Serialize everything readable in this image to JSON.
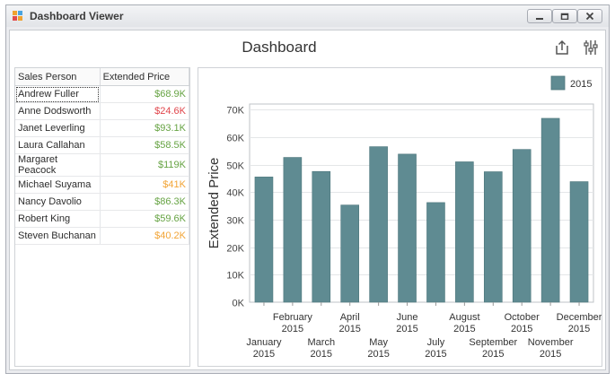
{
  "window": {
    "title": "Dashboard Viewer",
    "controls": [
      "minimize",
      "maximize",
      "close"
    ]
  },
  "dashboard": {
    "title": "Dashboard",
    "tools": [
      "export-icon",
      "parameters-icon"
    ]
  },
  "grid": {
    "columns": [
      "Sales Person",
      "Extended Price"
    ],
    "rows": [
      {
        "name": "Andrew Fuller",
        "value": "$68.9K",
        "color": "#66a343"
      },
      {
        "name": "Anne Dodsworth",
        "value": "$24.6K",
        "color": "#e0454b"
      },
      {
        "name": "Janet Leverling",
        "value": "$93.1K",
        "color": "#66a343"
      },
      {
        "name": "Laura Callahan",
        "value": "$58.5K",
        "color": "#66a343"
      },
      {
        "name": "Margaret Peacock",
        "value": "$119K",
        "color": "#66a343"
      },
      {
        "name": "Michael Suyama",
        "value": "$41K",
        "color": "#f2a435"
      },
      {
        "name": "Nancy Davolio",
        "value": "$86.3K",
        "color": "#66a343"
      },
      {
        "name": "Robert King",
        "value": "$59.6K",
        "color": "#66a343"
      },
      {
        "name": "Steven Buchanan",
        "value": "$40.2K",
        "color": "#f2a435"
      }
    ],
    "selected_row": 0
  },
  "chart_data": {
    "type": "bar",
    "title": "",
    "xlabel": "",
    "ylabel": "Extended Price",
    "categories": [
      "January 2015",
      "February 2015",
      "March 2015",
      "April 2015",
      "May 2015",
      "June 2015",
      "July 2015",
      "August 2015",
      "September 2015",
      "October 2015",
      "November 2015",
      "December 2015"
    ],
    "category_lines": [
      [
        "January",
        "2015"
      ],
      [
        "February",
        "2015"
      ],
      [
        "March",
        "2015"
      ],
      [
        "April",
        "2015"
      ],
      [
        "May",
        "2015"
      ],
      [
        "June",
        "2015"
      ],
      [
        "July",
        "2015"
      ],
      [
        "August",
        "2015"
      ],
      [
        "September",
        "2015"
      ],
      [
        "October",
        "2015"
      ],
      [
        "November",
        "2015"
      ],
      [
        "December",
        "2015"
      ]
    ],
    "series": [
      {
        "name": "2015",
        "color": "#5f8b92",
        "values": [
          45500,
          52600,
          47500,
          35300,
          56500,
          53800,
          36200,
          51000,
          47400,
          55500,
          66800,
          43800
        ]
      }
    ],
    "yticks": [
      "0K",
      "10K",
      "20K",
      "30K",
      "40K",
      "50K",
      "60K",
      "70K"
    ],
    "ylim": [
      0,
      72000
    ],
    "grid": true,
    "legend": "top-right"
  }
}
